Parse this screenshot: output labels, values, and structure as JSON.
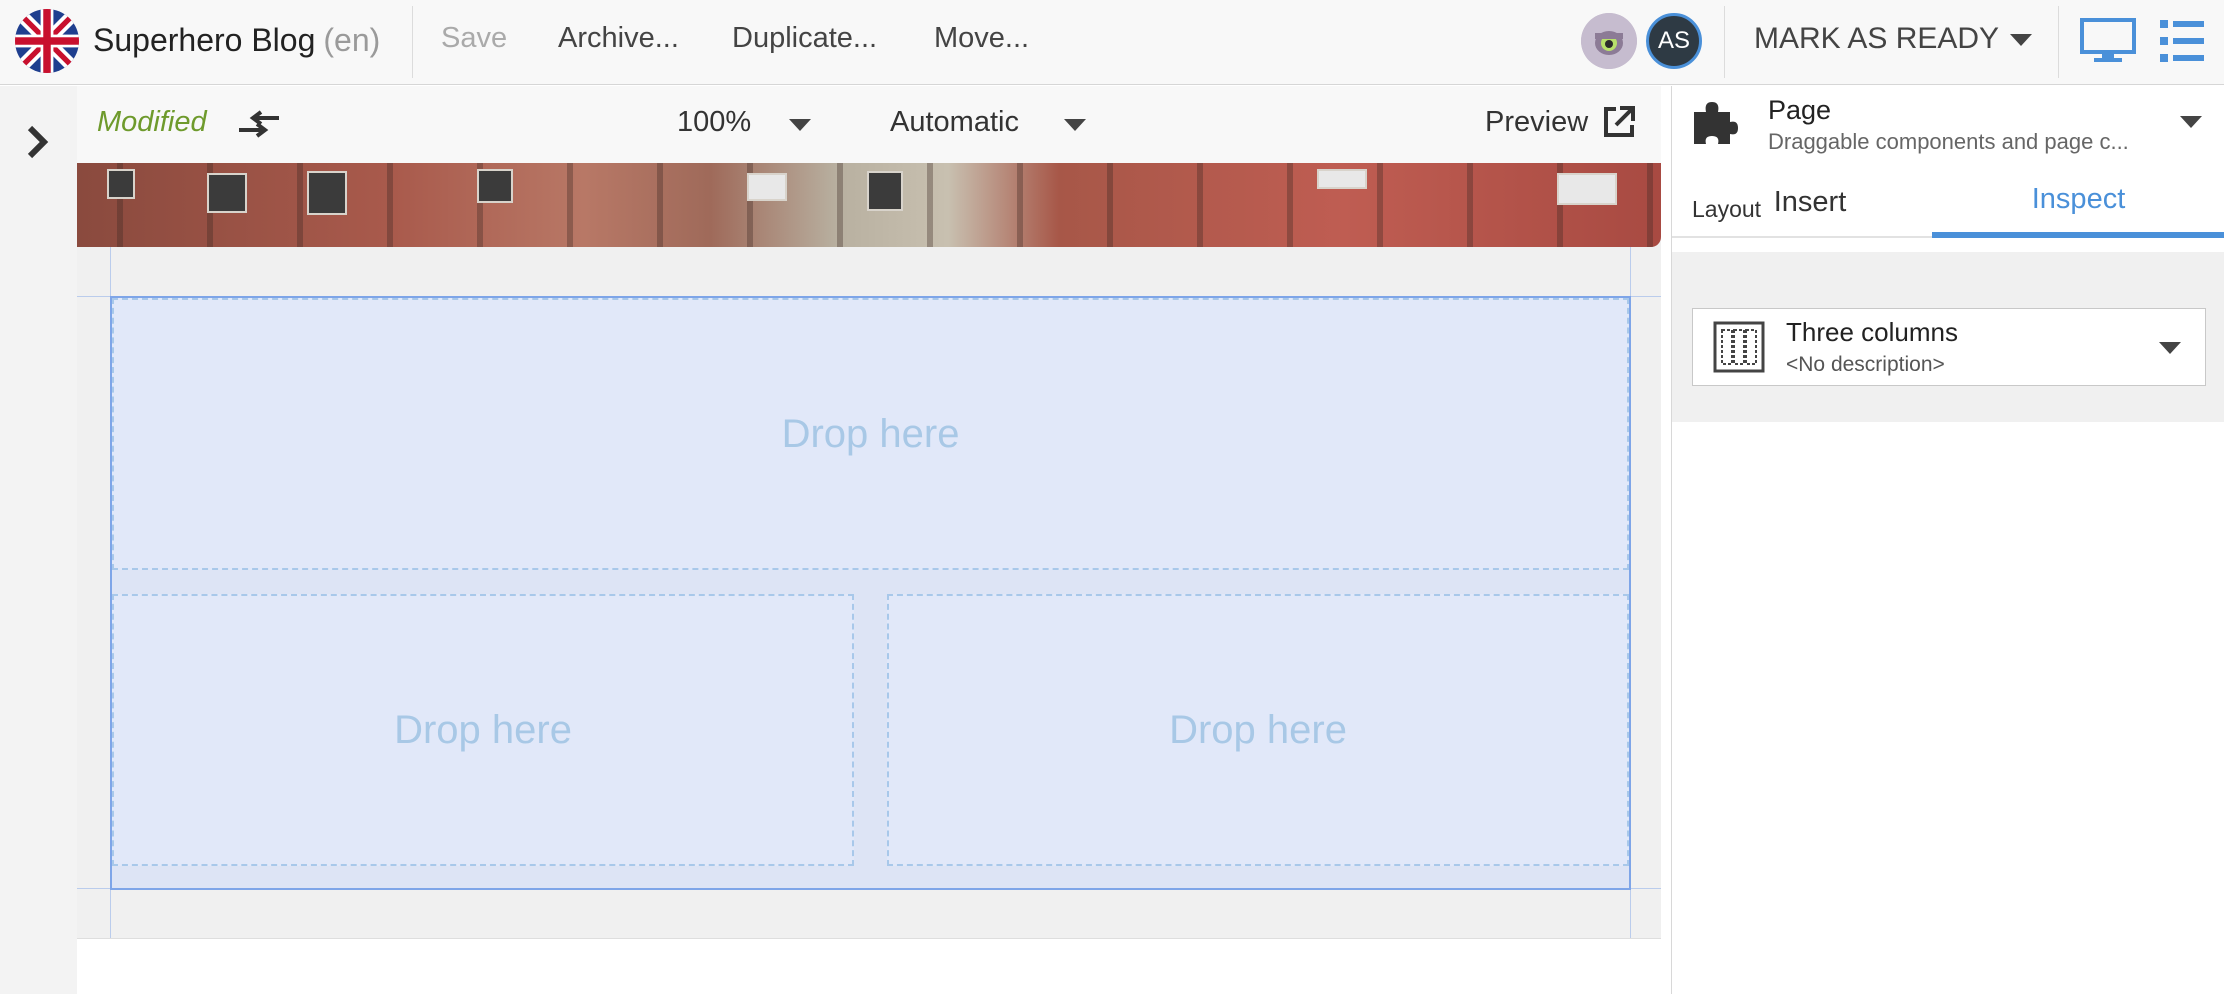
{
  "header": {
    "title": "Superhero Blog",
    "language": "(en)",
    "buttons": {
      "save": "Save",
      "archive": "Archive...",
      "duplicate": "Duplicate...",
      "move": "Move..."
    },
    "avatar_initials": "AS",
    "mark_ready": "MARK AS READY"
  },
  "canvas_toolbar": {
    "status": "Modified",
    "zoom": "100%",
    "device": "Automatic",
    "preview": "Preview"
  },
  "canvas": {
    "drop_zones": [
      "Drop here",
      "Drop here",
      "Drop here"
    ]
  },
  "inspector": {
    "component_title": "Page",
    "component_subtitle": "Draggable components and page c...",
    "tabs": [
      "Insert",
      "Inspect"
    ],
    "active_tab": "Inspect",
    "layout_label": "Layout",
    "layout_value": "Three columns",
    "layout_description": "<No description>"
  },
  "colors": {
    "accent": "#4a90d9",
    "modified": "#6e9a2c",
    "drop_zone_fill": "#e1e8f9",
    "drop_zone_text": "#a8c8e6"
  }
}
